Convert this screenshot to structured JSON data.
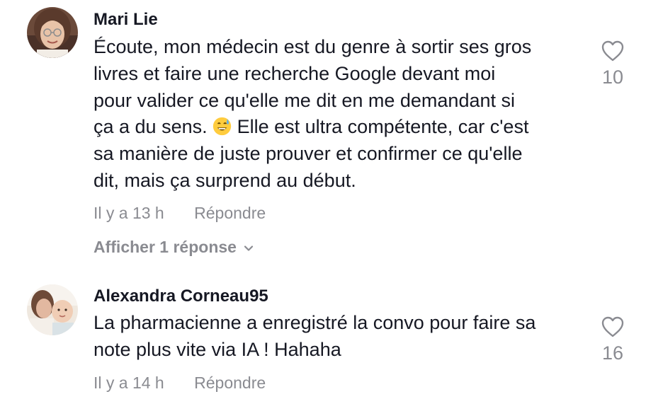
{
  "comments": [
    {
      "username": "Mari Lie",
      "avatar_icon": "user-avatar",
      "text_lines": [
        "Écoute, mon médecin est du genre à sortir ses gros",
        "livres et faire une recherche Google devant moi",
        "pour valider ce qu'elle me dit en me demandant si"
      ],
      "line4_before_emoji": "ça a du sens. ",
      "emoji": "grinning-sweat-emoji",
      "line4_after_emoji": " Elle est ultra compétente, car c'est",
      "text_lines_after": [
        "sa manière de juste prouver et confirmer ce qu'elle",
        "dit, mais ça surprend au début."
      ],
      "time": "Il y a 13 h",
      "reply_label": "Répondre",
      "view_replies_label": "Afficher 1 réponse",
      "likes": "10"
    },
    {
      "username": "Alexandra Corneau95",
      "avatar_icon": "user-avatar",
      "text_lines": [
        "La pharmacienne a enregistré la convo pour faire sa",
        "note plus vite via IA ! Hahaha"
      ],
      "time": "Il y a 14 h",
      "reply_label": "Répondre",
      "likes": "16"
    }
  ],
  "colors": {
    "text": "#161823",
    "secondary": "#8a8b91"
  }
}
